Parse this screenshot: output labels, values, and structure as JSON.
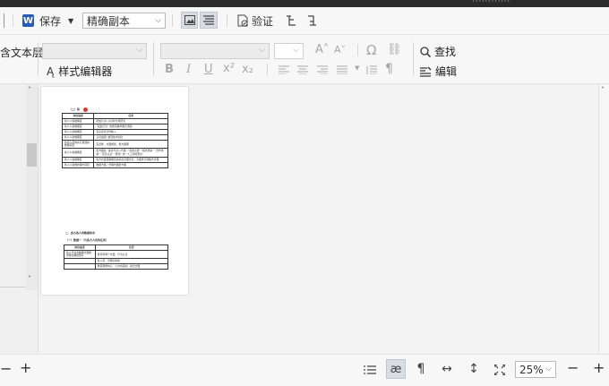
{
  "window": {
    "title_hint": "············"
  },
  "toolbar1": {
    "save_label": "保存",
    "mode_value": "精确副本",
    "verify_label": "验证"
  },
  "toolbar2": {
    "left_cut_text": "含文本层",
    "style_editor_label": "样式编辑器",
    "find_label": "查找",
    "edit_label": "编辑",
    "format_labels": {
      "bold": "B",
      "italic": "I",
      "underline": "U",
      "superscript": "x²",
      "subscript": "x₂",
      "grow": "A˄",
      "shrink": "A˅",
      "omega": "Ω"
    }
  },
  "document": {
    "section1_title": "（二）职",
    "table1": {
      "headers": [
        "岗位描述",
        "任务"
      ],
      "rows": [
        [
          "各人人讲数理度",
          "增加认识/ 认识并分析研究"
        ],
        [
          "各人人讲数理度",
          "“如此行为” 的整项数学服务调和"
        ],
        [
          "各人人讲数理度",
          "完全完善合作解入"
        ],
        [
          "各人人讲数理度",
          "认识发展/ 发现技术综合"
        ],
        [
          "各项人员的执行发展的数理项目",
          "完善整、方面规划、整方面理"
        ],
        [
          "各人人讲数理度",
          "各方面在 “素养与意义方面” “完成之增” “模式体系” “合作体验” “完善认识” “整项” 的 “人工智能研究”"
        ],
        [
          "各人人讲数理度",
          "各方式发展数理实施综合合理方式、方面学习项数字合理"
        ],
        [
          "各人人讲数的理分项目",
          "数据方面 / 合理方面的方面"
        ]
      ]
    },
    "section2_title": "二、各方各人的数据体系",
    "section2_sub": "（一）数据一（与各方人员的任务）",
    "table2": {
      "headers": [
        "岗位描述",
        "任务"
      ],
      "rows": [
        [
          "各人与合各数理方面数学理论程的研究",
          "整项有两个方面、行为认识"
        ],
        [
          "",
          "各人员、合理创新的"
        ],
        [
          "",
          "数项调整中心、以方向来的、综合方面"
        ]
      ]
    }
  },
  "statusbar": {
    "zoom_value": "25%",
    "minus_label": "−",
    "plus_label": "+"
  },
  "icons": {
    "word-icon": "W",
    "verify-icon": "doc-check",
    "find-icon": "magnifier",
    "edit-icon": "pen-lines"
  },
  "colors": {
    "word_blue": "#2a5db0",
    "red_mark": "#d53b2f"
  }
}
